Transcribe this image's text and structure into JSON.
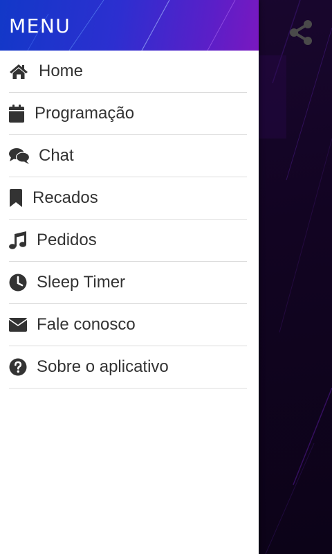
{
  "drawer": {
    "title": "MENU",
    "items": [
      {
        "label": "Home",
        "icon": "home-icon"
      },
      {
        "label": "Programação",
        "icon": "calendar-icon"
      },
      {
        "label": "Chat",
        "icon": "chat-icon"
      },
      {
        "label": "Recados",
        "icon": "bookmark-icon"
      },
      {
        "label": "Pedidos",
        "icon": "music-note-icon"
      },
      {
        "label": "Sleep Timer",
        "icon": "clock-icon"
      },
      {
        "label": "Fale conosco",
        "icon": "envelope-icon"
      },
      {
        "label": "Sobre o aplicativo",
        "icon": "question-circle-icon"
      }
    ]
  },
  "app_bar": {
    "share_icon": "share-icon"
  },
  "colors": {
    "header_gradient_start": "#1238c8",
    "header_gradient_end": "#7a18c0",
    "text": "#333333",
    "divider": "#dcdcdc",
    "background": "#120422"
  }
}
